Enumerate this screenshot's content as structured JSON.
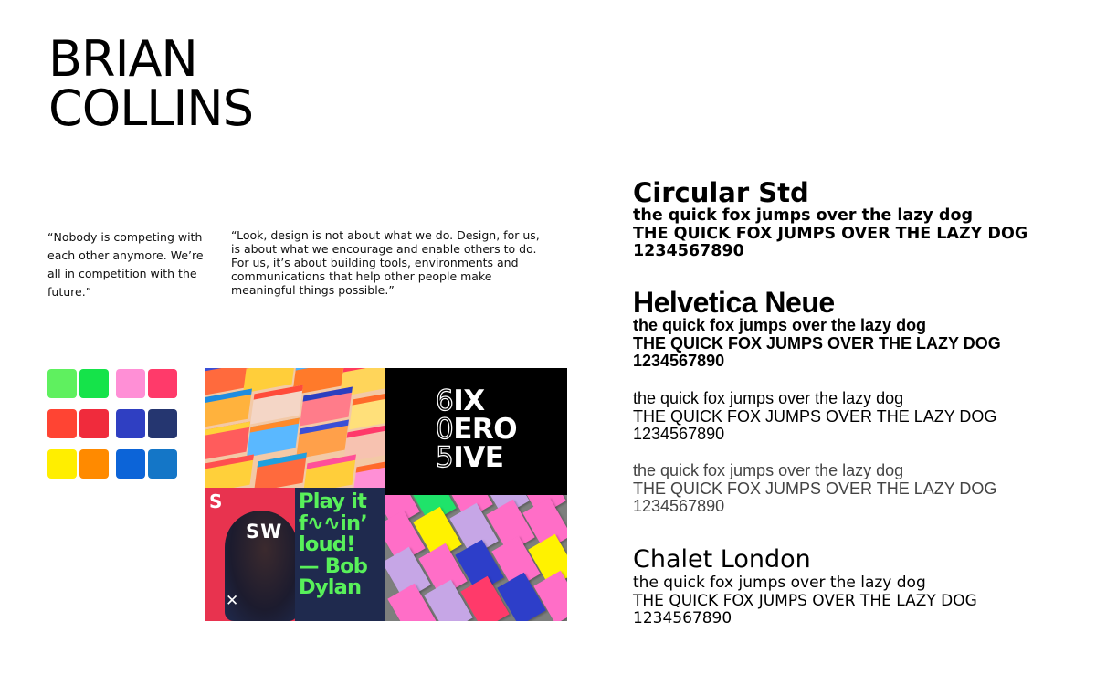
{
  "title": {
    "line1": "BRIAN",
    "line2": "COLLINS"
  },
  "quotes": [
    "“Nobody is competing with each other anymore. We’re all in competition with the future.”",
    "“Look, design is not about what we do. Design, for us, is about what we encourage and enable others to do. For us, it’s about building tools, environments and communications that help other people make meaningful things possible.”"
  ],
  "swatches": [
    "#5ff05f",
    "#15e34a",
    "#ff8fd6",
    "#ff3a6a",
    "#ff4433",
    "#f02b3c",
    "#2f3fc2",
    "#253670",
    "#ffee00",
    "#ff8a00",
    "#0c64d8",
    "#1476c7"
  ],
  "moodboard": {
    "poster_ix": {
      "line1_outline": "6",
      "line1": "IX",
      "line2_outline": "0",
      "line2": "ERO",
      "line3_outline": "5",
      "line3": "IVE"
    },
    "poster_sw": {
      "s": "S",
      "sw": "SW",
      "x": "✕"
    },
    "poster_green": {
      "line1": "Play it",
      "line2": "f∿∿in’",
      "line3": "loud!",
      "line4": "— Bob",
      "line5": "Dylan"
    }
  },
  "fonts": {
    "circular": {
      "name": "Circular Std",
      "lower": "the quick fox jumps over the lazy dog",
      "upper": "THE QUICK FOX JUMPS OVER THE LAZY DOG",
      "digits": "1234567890"
    },
    "helvetica": {
      "name": "Helvetica Neue",
      "lower": "the quick fox jumps over the lazy dog",
      "upper": "THE QUICK FOX JUMPS OVER THE LAZY DOG",
      "digits": "1234567890"
    },
    "helvetica_medium": {
      "lower": "the quick fox jumps over the lazy dog",
      "upper": "THE QUICK FOX JUMPS OVER THE LAZY DOG",
      "digits": "1234567890"
    },
    "helvetica_light": {
      "lower": "the quick fox jumps over the lazy dog",
      "upper": "THE QUICK FOX JUMPS OVER THE LAZY DOG",
      "digits": "1234567890"
    },
    "chalet": {
      "name": "Chalet London",
      "lower": "the quick fox jumps over the lazy dog",
      "upper": "THE QUICK FOX JUMPS OVER THE LAZY DOG",
      "digits": "1234567890"
    }
  }
}
